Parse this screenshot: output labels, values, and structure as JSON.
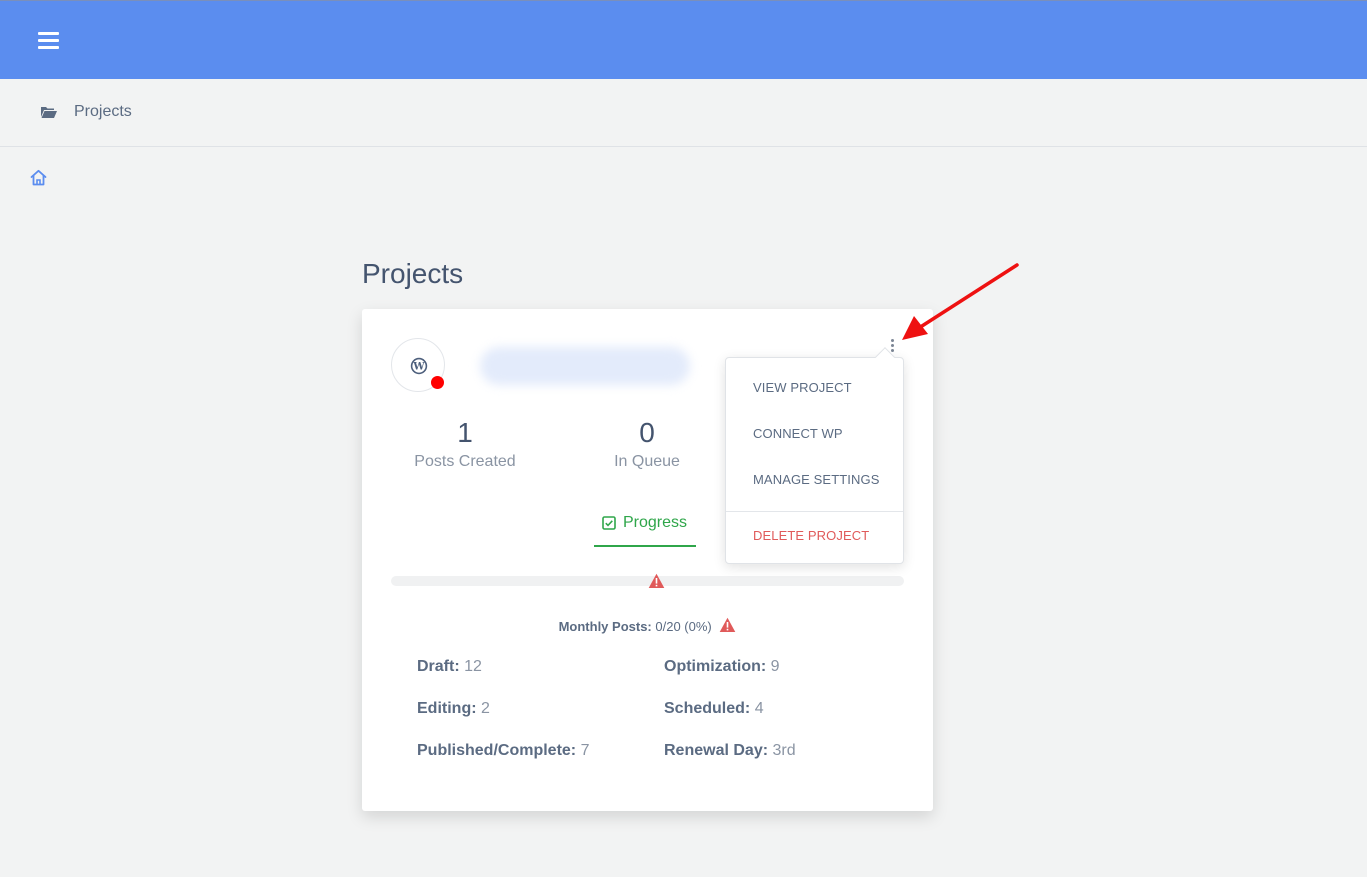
{
  "breadcrumb": {
    "label": "Projects"
  },
  "page": {
    "title": "Projects"
  },
  "project_card": {
    "stats": [
      {
        "value": "1",
        "label": "Posts Created"
      },
      {
        "value": "0",
        "label": "In Queue"
      }
    ],
    "tab_label": "Progress",
    "progress_fraction": 0,
    "monthly": {
      "label": "Monthly Posts:",
      "value": "0/20 (0%)"
    },
    "details": [
      {
        "label": "Draft:",
        "value": "12"
      },
      {
        "label": "Optimization:",
        "value": "9"
      },
      {
        "label": "Editing:",
        "value": "2"
      },
      {
        "label": "Scheduled:",
        "value": "4"
      },
      {
        "label": "Published/Complete:",
        "value": "7"
      },
      {
        "label": "Renewal Day:",
        "value": "3rd"
      }
    ]
  },
  "menu": {
    "items": [
      "VIEW PROJECT",
      "CONNECT WP",
      "MANAGE SETTINGS"
    ],
    "danger_item": "DELETE PROJECT"
  },
  "colors": {
    "topbar": "#5b8def",
    "accent_green": "#2fa64a",
    "danger": "#e05a5a",
    "status_dot": "#ff0000",
    "annotation_arrow": "#ee1111"
  },
  "icons": [
    "hamburger-icon",
    "folder-open-icon",
    "home-icon",
    "wordpress-icon",
    "kebab-menu-icon",
    "checkbox-check-icon",
    "warning-icon"
  ]
}
